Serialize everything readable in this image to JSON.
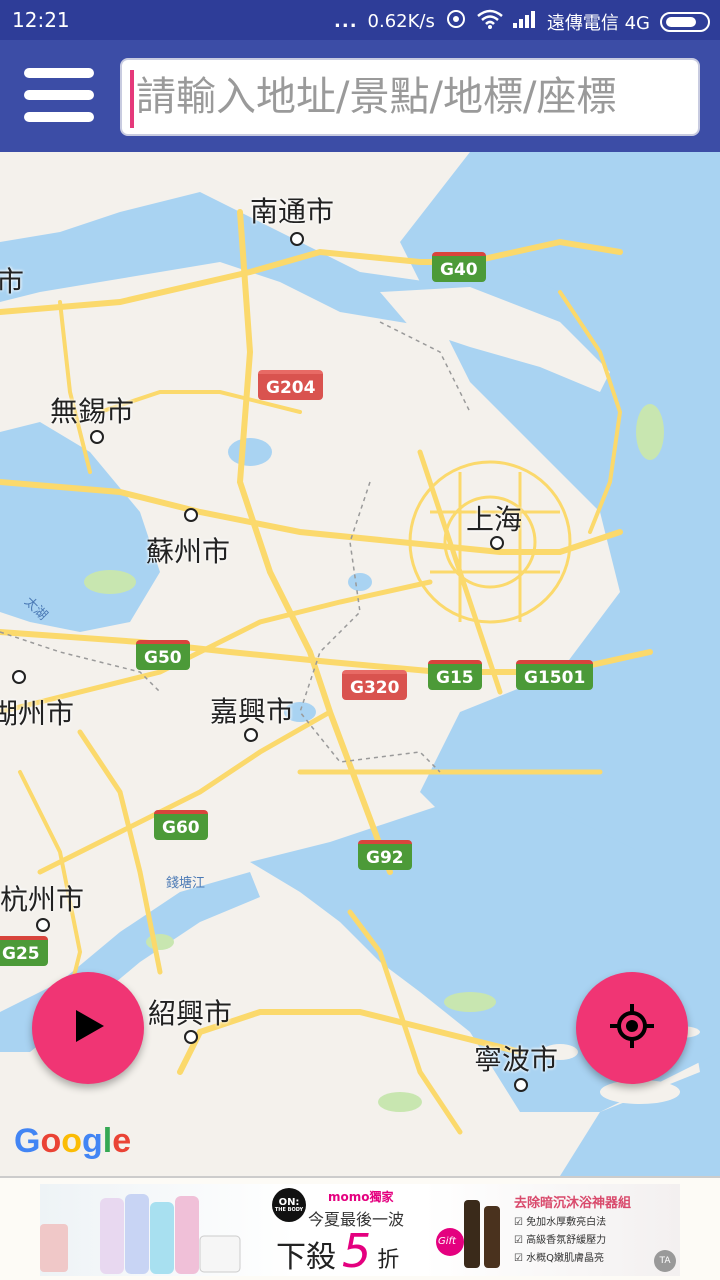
{
  "status_bar": {
    "time": "12:21",
    "dots": "...",
    "net_speed": "0.62K/s",
    "carrier": "遠傳電信 4G"
  },
  "app_bar": {
    "search_placeholder": "請輸入地址/景點/地標/座標"
  },
  "map": {
    "cities": {
      "nantong": "南通市",
      "wuxi": "無錫市",
      "suzhou": "蘇州市",
      "shanghai": "上海",
      "jiaxing": "嘉興市",
      "hangzhou": "杭州市",
      "shaoxing": "紹興市",
      "ningbo": "寧波市",
      "left_top": "市",
      "huzhou": "湖州市"
    },
    "water": {
      "taihu": "太湖",
      "qiantang": "錢塘江"
    },
    "highways": {
      "g40": "G40",
      "g204": "G204",
      "g50": "G50",
      "g320": "G320",
      "g15": "G15",
      "g1501": "G1501",
      "g60": "G60",
      "g92": "G92",
      "g25": "G25"
    },
    "google_logo": "Google",
    "colors": {
      "land": "#f2efe9",
      "water": "#a9d3f2",
      "road": "#fbd96c",
      "accent": "#f03574",
      "app_bar": "#3c4da6"
    }
  },
  "buttons": {
    "play_icon": "play-icon",
    "locate_icon": "crosshair-icon"
  },
  "ad": {
    "brand_badge": "ON:",
    "brand_sub": "THE BODY",
    "momo": "momo獨家",
    "headline": "今夏最後一波",
    "sale": "下殺",
    "sale_num": "5",
    "sale_unit": "折",
    "right_title": "去除暗沉沐浴神器組",
    "bullet1": "免加水厚敷亮白法",
    "bullet2": "高級香氛舒緩壓力",
    "bullet3": "水概Q嫩肌膚晶亮",
    "gift": "Gift"
  }
}
